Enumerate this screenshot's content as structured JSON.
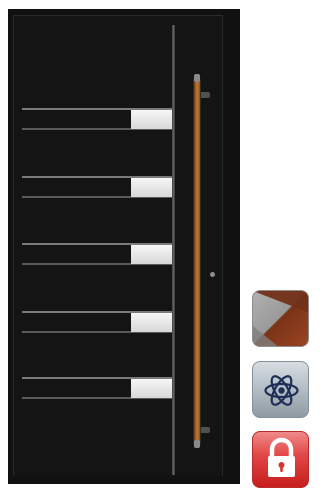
{
  "door": {
    "inlay_count": 5,
    "handle_color": "#c67a35",
    "panel_color": "#141414",
    "glass_color": "#e8e8e8"
  },
  "side_controls": {
    "items": [
      {
        "name": "color-swatch",
        "icon": "color-swatch-icon",
        "accent": "#7a3318"
      },
      {
        "name": "atom",
        "icon": "atom-icon",
        "accent": "#1f2f57"
      },
      {
        "name": "lock",
        "icon": "lock-icon",
        "accent": "#e24646"
      }
    ]
  }
}
